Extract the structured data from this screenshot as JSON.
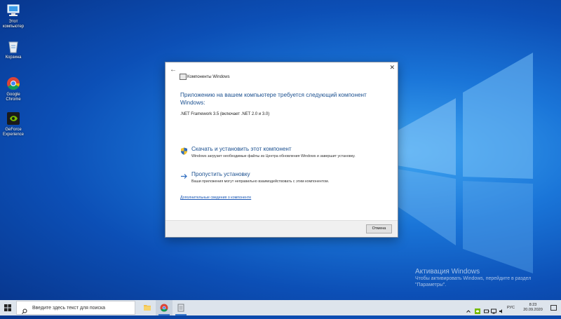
{
  "desktop": {
    "icons": [
      {
        "label": "Этот компьютер",
        "icon": "computer-icon"
      },
      {
        "label": "Корзина",
        "icon": "recycle-bin-icon"
      },
      {
        "label": "Google Chrome",
        "icon": "chrome-icon"
      },
      {
        "label": "GeForce Experience",
        "icon": "geforce-icon"
      }
    ]
  },
  "dialog": {
    "title": "Компоненты Windows",
    "heading": "Приложению на вашем компьютере требуется следующий компонент Windows:",
    "component": ".NET Framework 3.5 (включает .NET 2.0 и 3.0)",
    "option_download": {
      "title": "Скачать и установить этот компонент",
      "description": "Windows загрузит необходимые файлы из Центра обновления Windows и завершит установку.",
      "icon": "uac-shield-icon"
    },
    "option_skip": {
      "title": "Пропустить установку",
      "description": "Ваши приложения могут неправильно взаимодействовать с этим компонентом.",
      "icon": "arrow-right-icon"
    },
    "details_link": "Дополнительные сведения о компоненте",
    "cancel_label": "Отмена"
  },
  "activation": {
    "title": "Активация Windows",
    "text": "Чтобы активировать Windows, перейдите в раздел \"Параметры\"."
  },
  "taskbar": {
    "search_placeholder": "Введите здесь текст для поиска",
    "pinned": [
      {
        "name": "file-explorer-icon"
      },
      {
        "name": "chrome-icon"
      },
      {
        "name": "windows-features-icon"
      }
    ],
    "language": "РУС",
    "time": "8:23",
    "date": "20.09.2020"
  }
}
